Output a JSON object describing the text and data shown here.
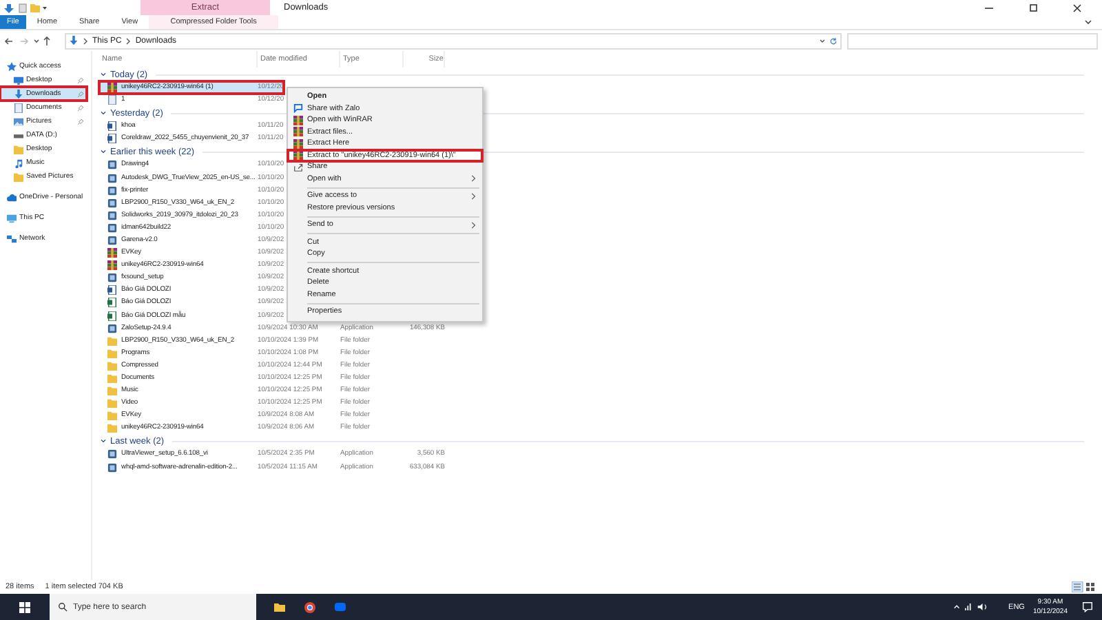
{
  "window": {
    "title": "Downloads"
  },
  "ribbon": {
    "context_label": "Extract",
    "tabs": [
      {
        "label": "File",
        "selected": true
      },
      {
        "label": "Home",
        "selected": false
      },
      {
        "label": "Share",
        "selected": false
      },
      {
        "label": "View",
        "selected": false
      },
      {
        "label": "Compressed Folder Tools",
        "selected": false
      }
    ]
  },
  "address": {
    "path": [
      "This PC",
      "Downloads"
    ]
  },
  "nav": [
    {
      "label": "Quick access",
      "kind": "star",
      "pinned": false,
      "selected": false,
      "highlighted": false,
      "children": [
        {
          "label": "Desktop",
          "kind": "desktop",
          "pinned": true,
          "selected": false,
          "highlighted": false
        },
        {
          "label": "Downloads",
          "kind": "download",
          "pinned": true,
          "selected": true,
          "highlighted": true
        },
        {
          "label": "Documents",
          "kind": "document",
          "pinned": true,
          "selected": false,
          "highlighted": false
        },
        {
          "label": "Pictures",
          "kind": "picture",
          "pinned": true,
          "selected": false,
          "highlighted": false
        },
        {
          "label": "DATA (D:)",
          "kind": "drive",
          "pinned": false,
          "selected": false,
          "highlighted": false
        },
        {
          "label": "Desktop",
          "kind": "folder",
          "pinned": false,
          "selected": false,
          "highlighted": false
        },
        {
          "label": "Music",
          "kind": "music",
          "pinned": false,
          "selected": false,
          "highlighted": false
        },
        {
          "label": "Saved Pictures",
          "kind": "folder",
          "pinned": false,
          "selected": false,
          "highlighted": false
        }
      ]
    },
    {
      "label": "OneDrive - Personal",
      "kind": "cloud",
      "pinned": false,
      "selected": false,
      "highlighted": false
    },
    {
      "label": "This PC",
      "kind": "pc",
      "pinned": false,
      "selected": false,
      "highlighted": false
    },
    {
      "label": "Network",
      "kind": "network",
      "pinned": false,
      "selected": false,
      "highlighted": false
    }
  ],
  "columns": [
    "Name",
    "Date modified",
    "Type",
    "Size"
  ],
  "groups": [
    {
      "label": "Today (2)",
      "expanded": true,
      "rows": [
        {
          "name": "unikey46RC2-230919-win64 (1)",
          "date": "10/12/20",
          "kind": "archive",
          "selected": true,
          "highlighted": true
        },
        {
          "name": "1",
          "date": "10/12/20",
          "kind": "file",
          "selected": false,
          "highlighted": false
        }
      ]
    },
    {
      "label": "Yesterday (2)",
      "expanded": true,
      "rows": [
        {
          "name": "khoa",
          "date": "10/11/20",
          "kind": "document",
          "selected": false,
          "highlighted": false
        },
        {
          "name": "Coreldraw_2022_5455_chuyenvienit_20_37",
          "date": "10/11/20",
          "kind": "document",
          "selected": false,
          "highlighted": false
        }
      ]
    },
    {
      "label": "Earlier this week (22)",
      "expanded": true,
      "rows": [
        {
          "name": "Drawing4",
          "date": "10/10/20",
          "kind": "app",
          "selected": false,
          "highlighted": false
        },
        {
          "name": "Autodesk_DWG_TrueView_2025_en-US_se...",
          "date": "10/10/20",
          "kind": "app",
          "selected": false,
          "highlighted": false
        },
        {
          "name": "fix-printer",
          "date": "10/10/20",
          "kind": "app",
          "selected": false,
          "highlighted": false
        },
        {
          "name": "LBP2900_R150_V330_W64_uk_EN_2",
          "date": "10/10/20",
          "kind": "app",
          "selected": false,
          "highlighted": false
        },
        {
          "name": "Solidworks_2019_30979_itdolozi_20_23",
          "date": "10/10/20",
          "kind": "app",
          "selected": false,
          "highlighted": false
        },
        {
          "name": "idman642build22",
          "date": "10/10/20",
          "kind": "app",
          "selected": false,
          "highlighted": false
        },
        {
          "name": "Garena-v2.0",
          "date": "10/9/202",
          "kind": "app",
          "selected": false,
          "highlighted": false
        },
        {
          "name": "EVKey",
          "date": "10/9/202",
          "kind": "archive",
          "selected": false,
          "highlighted": false
        },
        {
          "name": "unikey46RC2-230919-win64",
          "date": "10/9/202",
          "kind": "archive",
          "selected": false,
          "highlighted": false
        },
        {
          "name": "fxsound_setup",
          "date": "10/9/202",
          "kind": "app",
          "selected": false,
          "highlighted": false
        },
        {
          "name": "Báo Giá DOLOZI",
          "date": "10/9/202",
          "kind": "document",
          "selected": false,
          "highlighted": false
        },
        {
          "name": "Báo Giá DOLOZI",
          "date": "10/9/202",
          "kind": "sheet",
          "selected": false,
          "highlighted": false
        },
        {
          "name": "Báo Giá DOLOZI mẫu",
          "date": "10/9/202",
          "kind": "sheet",
          "selected": false,
          "highlighted": false
        },
        {
          "name": "ZaloSetup-24.9.4",
          "date": "10/9/2024 10:30 AM",
          "type": "Application",
          "size": "146,308 KB",
          "kind": "app",
          "selected": false,
          "highlighted": false
        },
        {
          "name": "LBP2900_R150_V330_W64_uk_EN_2",
          "date": "10/10/2024 1:39 PM",
          "type": "File folder",
          "kind": "folder",
          "selected": false,
          "highlighted": false
        },
        {
          "name": "Programs",
          "date": "10/10/2024 1:08 PM",
          "type": "File folder",
          "kind": "folder",
          "selected": false,
          "highlighted": false
        },
        {
          "name": "Compressed",
          "date": "10/10/2024 12:44 PM",
          "type": "File folder",
          "kind": "folder",
          "selected": false,
          "highlighted": false
        },
        {
          "name": "Documents",
          "date": "10/10/2024 12:25 PM",
          "type": "File folder",
          "kind": "folder",
          "selected": false,
          "highlighted": false
        },
        {
          "name": "Music",
          "date": "10/10/2024 12:25 PM",
          "type": "File folder",
          "kind": "folder",
          "selected": false,
          "highlighted": false
        },
        {
          "name": "Video",
          "date": "10/10/2024 12:25 PM",
          "type": "File folder",
          "kind": "folder",
          "selected": false,
          "highlighted": false
        },
        {
          "name": "EVKey",
          "date": "10/9/2024 8:08 AM",
          "type": "File folder",
          "kind": "folder",
          "selected": false,
          "highlighted": false
        },
        {
          "name": "unikey46RC2-230919-win64",
          "date": "10/9/2024 8:06 AM",
          "type": "File folder",
          "kind": "folder",
          "selected": false,
          "highlighted": false
        }
      ]
    },
    {
      "label": "Last week (2)",
      "expanded": true,
      "rows": [
        {
          "name": "UltraViewer_setup_6.6.108_vi",
          "date": "10/5/2024 2:35 PM",
          "type": "Application",
          "size": "3,560 KB",
          "kind": "app",
          "selected": false,
          "highlighted": false
        },
        {
          "name": "whql-amd-software-adrenalin-edition-2...",
          "date": "10/5/2024 11:15 AM",
          "type": "Application",
          "size": "633,084 KB",
          "kind": "app",
          "selected": false,
          "highlighted": false
        }
      ]
    }
  ],
  "context_menu": [
    {
      "kind": "default",
      "label": "Open",
      "submenu": false,
      "highlighted": false
    },
    {
      "kind": "chat",
      "label": "Share with Zalo",
      "submenu": false,
      "highlighted": false
    },
    {
      "kind": "archive",
      "label": "Open with WinRAR",
      "submenu": false,
      "highlighted": false
    },
    {
      "kind": "archive",
      "label": "Extract files...",
      "submenu": false,
      "highlighted": false
    },
    {
      "kind": "archive",
      "label": "Extract Here",
      "submenu": false,
      "highlighted": false
    },
    {
      "kind": "archive",
      "label": "Extract to \"unikey46RC2-230919-win64 (1)\\\"",
      "submenu": false,
      "highlighted": true
    },
    {
      "kind": "share",
      "label": "Share",
      "submenu": false,
      "highlighted": false
    },
    {
      "kind": "plain",
      "label": "Open with",
      "submenu": true,
      "highlighted": false
    },
    {
      "kind": "separator"
    },
    {
      "kind": "plain",
      "label": "Give access to",
      "submenu": true,
      "highlighted": false
    },
    {
      "kind": "plain",
      "label": "Restore previous versions",
      "submenu": false,
      "highlighted": false
    },
    {
      "kind": "separator"
    },
    {
      "kind": "plain",
      "label": "Send to",
      "submenu": true,
      "highlighted": false
    },
    {
      "kind": "separator"
    },
    {
      "kind": "plain",
      "label": "Cut",
      "submenu": false,
      "highlighted": false
    },
    {
      "kind": "plain",
      "label": "Copy",
      "submenu": false,
      "highlighted": false
    },
    {
      "kind": "separator"
    },
    {
      "kind": "plain",
      "label": "Create shortcut",
      "submenu": false,
      "highlighted": false
    },
    {
      "kind": "plain",
      "label": "Delete",
      "submenu": false,
      "highlighted": false
    },
    {
      "kind": "plain",
      "label": "Rename",
      "submenu": false,
      "highlighted": false
    },
    {
      "kind": "separator"
    },
    {
      "kind": "plain",
      "label": "Properties",
      "submenu": false,
      "highlighted": false
    }
  ],
  "status_bar": {
    "items": "28 items",
    "selection": "1 item selected  704 KB"
  },
  "taskbar": {
    "search": {
      "placeholder": "Type here to search"
    },
    "language": "ENG",
    "time": "9:30 AM",
    "date": "10/12/2024"
  }
}
